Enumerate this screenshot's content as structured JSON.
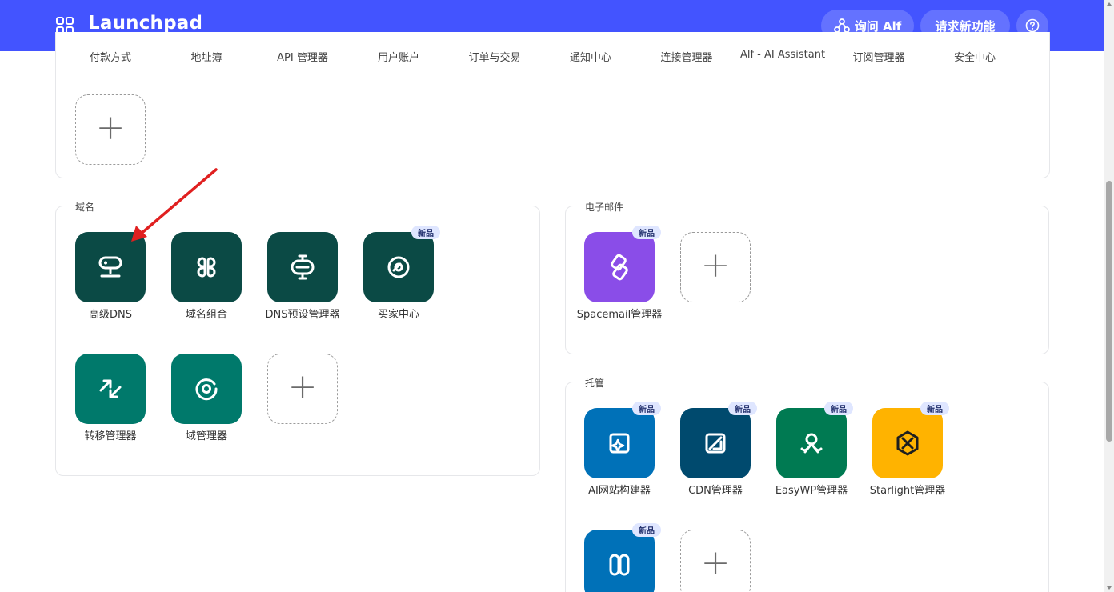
{
  "header": {
    "title": "Launchpad",
    "ask_label": "询问 Alf",
    "request_label": "请求新功能",
    "bg_color": "#4354ff"
  },
  "top_section": {
    "labels": [
      "付款方式",
      "地址簿",
      "API 管理器",
      "用户账户",
      "订单与交易",
      "通知中心",
      "连接管理器",
      "Alf - AI Assistant",
      "订阅管理器",
      "安全中心"
    ]
  },
  "domain_section": {
    "title": "域名",
    "tiles": [
      {
        "label": "高级DNS",
        "icon": "dns-icon",
        "color": "#0b4a45"
      },
      {
        "label": "域名组合",
        "icon": "portfolio-icon",
        "color": "#0b4a45"
      },
      {
        "label": "DNS预设管理器",
        "icon": "preset-icon",
        "color": "#0b4a45"
      },
      {
        "label": "买家中心",
        "icon": "buyer-icon",
        "color": "#0b4a45",
        "badge": "新品"
      },
      {
        "label": "转移管理器",
        "icon": "transfer-icon",
        "color": "#00796b"
      },
      {
        "label": "域管理器",
        "icon": "domain-manager-icon",
        "color": "#00796b"
      }
    ]
  },
  "email_section": {
    "title": "电子邮件",
    "tiles": [
      {
        "label": "Spacemail管理器",
        "icon": "spacemail-icon",
        "color": "#8a4de8",
        "badge": "新品"
      }
    ]
  },
  "hosting_section": {
    "title": "托管",
    "tiles": [
      {
        "label": "AI网站构建器",
        "icon": "ai-builder-icon",
        "color": "#0071b8",
        "badge": "新品"
      },
      {
        "label": "CDN管理器",
        "icon": "cdn-icon",
        "color": "#004a6e",
        "badge": "新品"
      },
      {
        "label": "EasyWP管理器",
        "icon": "easywp-icon",
        "color": "#007a52",
        "badge": "新品"
      },
      {
        "label": "Starlight管理器",
        "icon": "starlight-icon",
        "color": "#ffb300",
        "badge": "新品"
      },
      {
        "label": "",
        "icon": "hosting-icon",
        "color": "#0071b8",
        "badge": "新品"
      }
    ]
  }
}
